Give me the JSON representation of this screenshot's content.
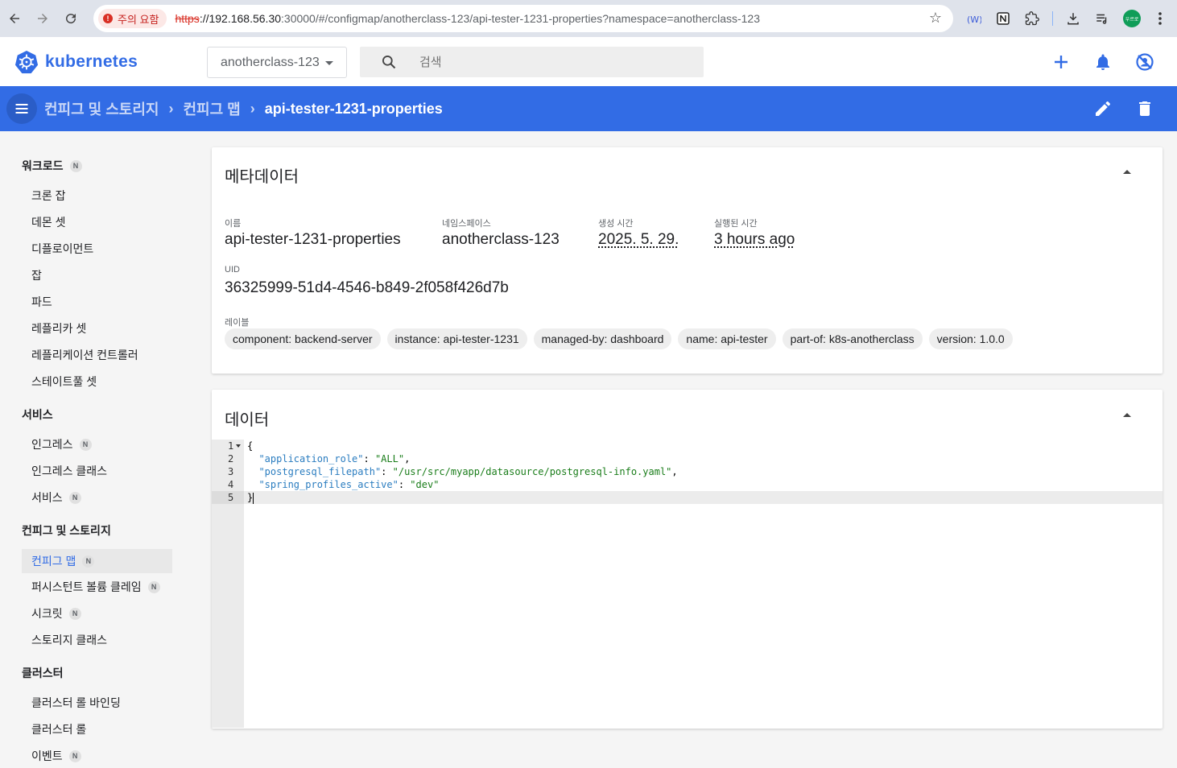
{
  "browser": {
    "security_warning": "주의 요함",
    "url_scheme": "https",
    "url_host": "://192.168.56.30",
    "url_rest": ":30000/#/configmap/anotherclass-123/api-tester-1231-properties?namespace=anotherclass-123",
    "profile_text": "우르로"
  },
  "header": {
    "logo_text": "kubernetes",
    "namespace": "anotherclass-123",
    "search_placeholder": "검색"
  },
  "toolbar": {
    "crumbs": [
      "컨피그 및 스토리지",
      "컨피그 맵",
      "api-tester-1231-properties"
    ]
  },
  "sidebar": {
    "groups": [
      {
        "label": "워크로드",
        "badge": "N",
        "items": [
          {
            "label": "크론 잡"
          },
          {
            "label": "데몬 셋"
          },
          {
            "label": "디플로이먼트"
          },
          {
            "label": "잡"
          },
          {
            "label": "파드"
          },
          {
            "label": "레플리카 셋"
          },
          {
            "label": "레플리케이션 컨트롤러"
          },
          {
            "label": "스테이트풀 셋"
          }
        ]
      },
      {
        "label": "서비스",
        "items": [
          {
            "label": "인그레스",
            "badge": "N"
          },
          {
            "label": "인그레스 클래스"
          },
          {
            "label": "서비스",
            "badge": "N"
          }
        ]
      },
      {
        "label": "컨피그 및 스토리지",
        "items": [
          {
            "label": "컨피그 맵",
            "badge": "N",
            "active": true
          },
          {
            "label": "퍼시스턴트 볼륨 클레임",
            "badge": "N"
          },
          {
            "label": "시크릿",
            "badge": "N"
          },
          {
            "label": "스토리지 클래스"
          }
        ]
      },
      {
        "label": "클러스터",
        "items": [
          {
            "label": "클러스터 롤 바인딩"
          },
          {
            "label": "클러스터 롤"
          },
          {
            "label": "이벤트",
            "badge": "N"
          }
        ]
      }
    ]
  },
  "metadata": {
    "title": "메타데이터",
    "name_label": "이름",
    "name": "api-tester-1231-properties",
    "namespace_label": "네임스페이스",
    "namespace": "anotherclass-123",
    "created_label": "생성 시간",
    "created": "2025. 5. 29.",
    "age_label": "실행된 시간",
    "age": "3 hours ago",
    "uid_label": "UID",
    "uid": "36325999-51d4-4546-b849-2f058f426d7b",
    "labels_label": "레이블",
    "labels": [
      "component: backend-server",
      "instance: api-tester-1231",
      "managed-by: dashboard",
      "name: api-tester",
      "part-of: k8s-anotherclass",
      "version: 1.0.0"
    ]
  },
  "data_card": {
    "title": "데이터",
    "line_numbers": [
      "1",
      "2",
      "3",
      "4",
      "5"
    ],
    "lines": [
      {
        "open": "{"
      },
      {
        "key": "\"application_role\"",
        "sep": ": ",
        "val": "\"ALL\"",
        "end": ","
      },
      {
        "key": "\"postgresql_filepath\"",
        "sep": ": ",
        "val": "\"/usr/src/myapp/datasource/postgresql-info.yaml\"",
        "end": ","
      },
      {
        "key": "\"spring_profiles_active\"",
        "sep": ": ",
        "val": "\"dev\"",
        "end": ""
      },
      {
        "open": "}"
      }
    ]
  }
}
